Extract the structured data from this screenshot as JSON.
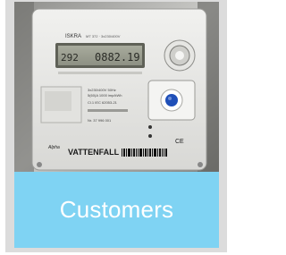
{
  "card": {
    "caption": "Customers",
    "band_color": "#7fd3f3"
  },
  "meter": {
    "model_label": "ISKRA",
    "display_left": "292",
    "display_reading": "0882.19",
    "brand": "VATTENFALL",
    "sub_brand": "Alpha",
    "ce_mark": "CE",
    "icons": [
      "electricity-meter-photo",
      "optical-port-icon",
      "blue-button-icon"
    ]
  }
}
